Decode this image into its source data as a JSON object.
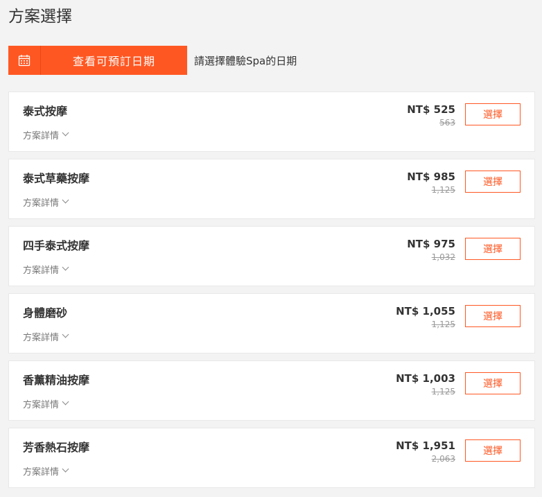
{
  "header": {
    "title": "方案選擇"
  },
  "date_bar": {
    "button_label": "查看可預訂日期",
    "hint": "請選擇體驗Spa的日期",
    "icon": "calendar-icon"
  },
  "plans": [
    {
      "name": "泰式按摩",
      "details_label": "方案詳情",
      "price": "NT$ 525",
      "original_price": "563",
      "select_label": "選擇"
    },
    {
      "name": "泰式草藥按摩",
      "details_label": "方案詳情",
      "price": "NT$ 985",
      "original_price": "1,125",
      "select_label": "選擇"
    },
    {
      "name": "四手泰式按摩",
      "details_label": "方案詳情",
      "price": "NT$ 975",
      "original_price": "1,032",
      "select_label": "選擇"
    },
    {
      "name": "身體磨砂",
      "details_label": "方案詳情",
      "price": "NT$ 1,055",
      "original_price": "1,125",
      "select_label": "選擇"
    },
    {
      "name": "香薰精油按摩",
      "details_label": "方案詳情",
      "price": "NT$ 1,003",
      "original_price": "1,125",
      "select_label": "選擇"
    },
    {
      "name": "芳香熱石按摩",
      "details_label": "方案詳情",
      "price": "NT$ 1,951",
      "original_price": "2,063",
      "select_label": "選擇"
    }
  ],
  "colors": {
    "accent": "#ff5722",
    "background": "#f3f3f3",
    "card": "#ffffff"
  }
}
